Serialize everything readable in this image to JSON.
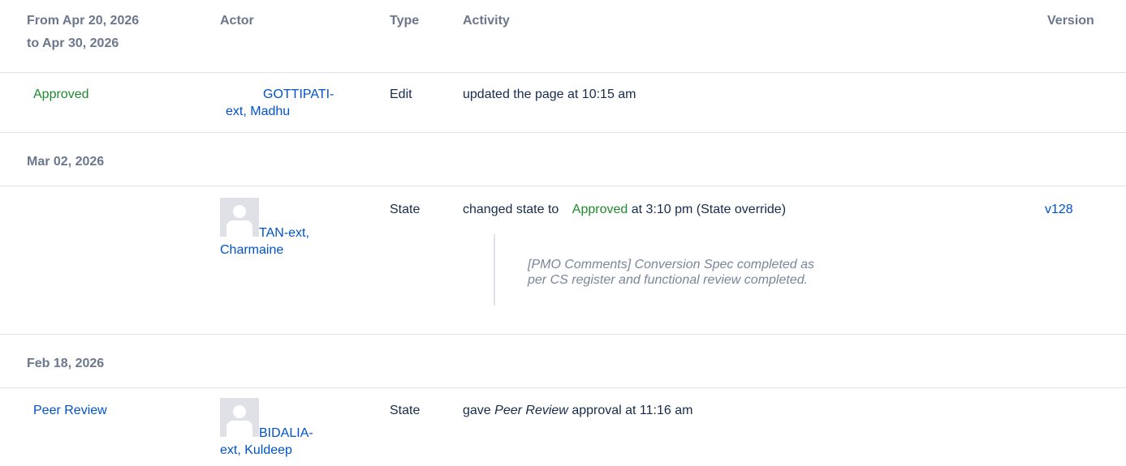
{
  "header": {
    "date_range_line1": "From Apr 20, 2026",
    "date_range_line2": "to Apr 30, 2026",
    "actor": "Actor",
    "type": "Type",
    "activity": "Activity",
    "version": "Version"
  },
  "rows": [
    {
      "state_label": "Approved",
      "actor_line1": "GOTTIPATI-",
      "actor_line2": "ext, Madhu",
      "type": "Edit",
      "activity": "updated the page at 10:15 am"
    },
    {
      "group_date": "Mar 02, 2026"
    },
    {
      "actor_line1": "TAN-ext,",
      "actor_line2": "Charmaine",
      "type": "State",
      "activity_prefix": "changed state to",
      "activity_state": "Approved",
      "activity_suffix": "at 3:10 pm (State override)",
      "version": "v128",
      "comment_line1": "[PMO Comments] Conversion Spec completed as",
      "comment_line2": "per CS register and functional review completed."
    },
    {
      "group_date": "Feb 18, 2026"
    },
    {
      "state_label": "Peer Review",
      "actor_line1": "BIDALIA-",
      "actor_line2": "ext, Kuldeep",
      "type": "State",
      "activity_prefix": "gave",
      "activity_state": "Peer Review",
      "activity_suffix": "approval at 11:16 am"
    }
  ],
  "colors": {
    "approved": "#1e8a2e",
    "link": "#0052cc",
    "header_text": "#6b778c",
    "divider": "#dfe1e6"
  },
  "icons": [
    "default-avatar-icon"
  ]
}
